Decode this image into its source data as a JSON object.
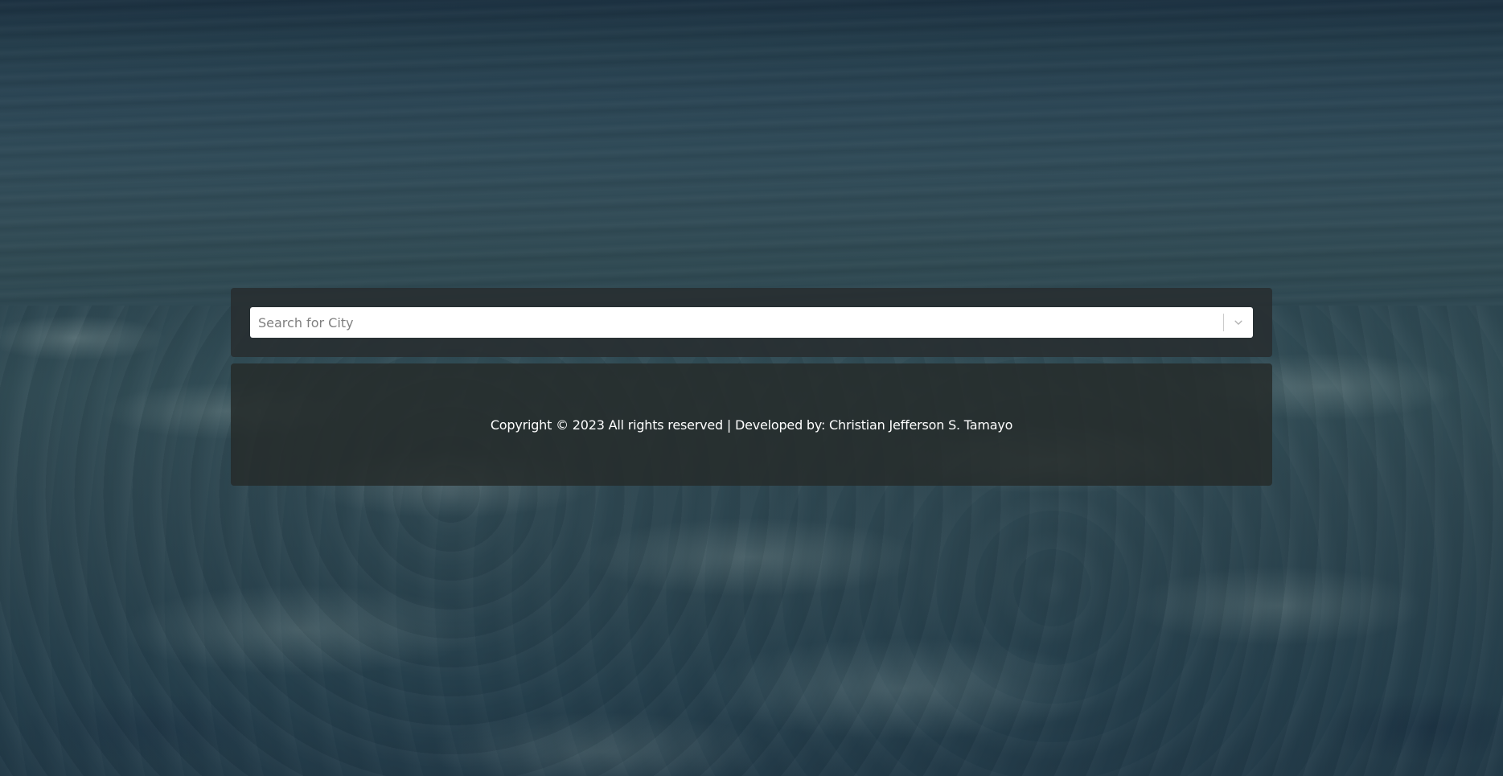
{
  "search": {
    "placeholder": "Search for City",
    "value": "",
    "dropdown_icon": "chevron-down-icon"
  },
  "footer": {
    "text": "Copyright © 2023 All rights reserved | Developed by: Christian Jefferson S. Tamayo"
  },
  "colors": {
    "panel_bg": "#282e30",
    "footer_bg": "#262c2a",
    "input_bg": "#ffffff",
    "text_white": "#ffffff",
    "placeholder": "#808080",
    "chevron": "#b3b3b3"
  }
}
